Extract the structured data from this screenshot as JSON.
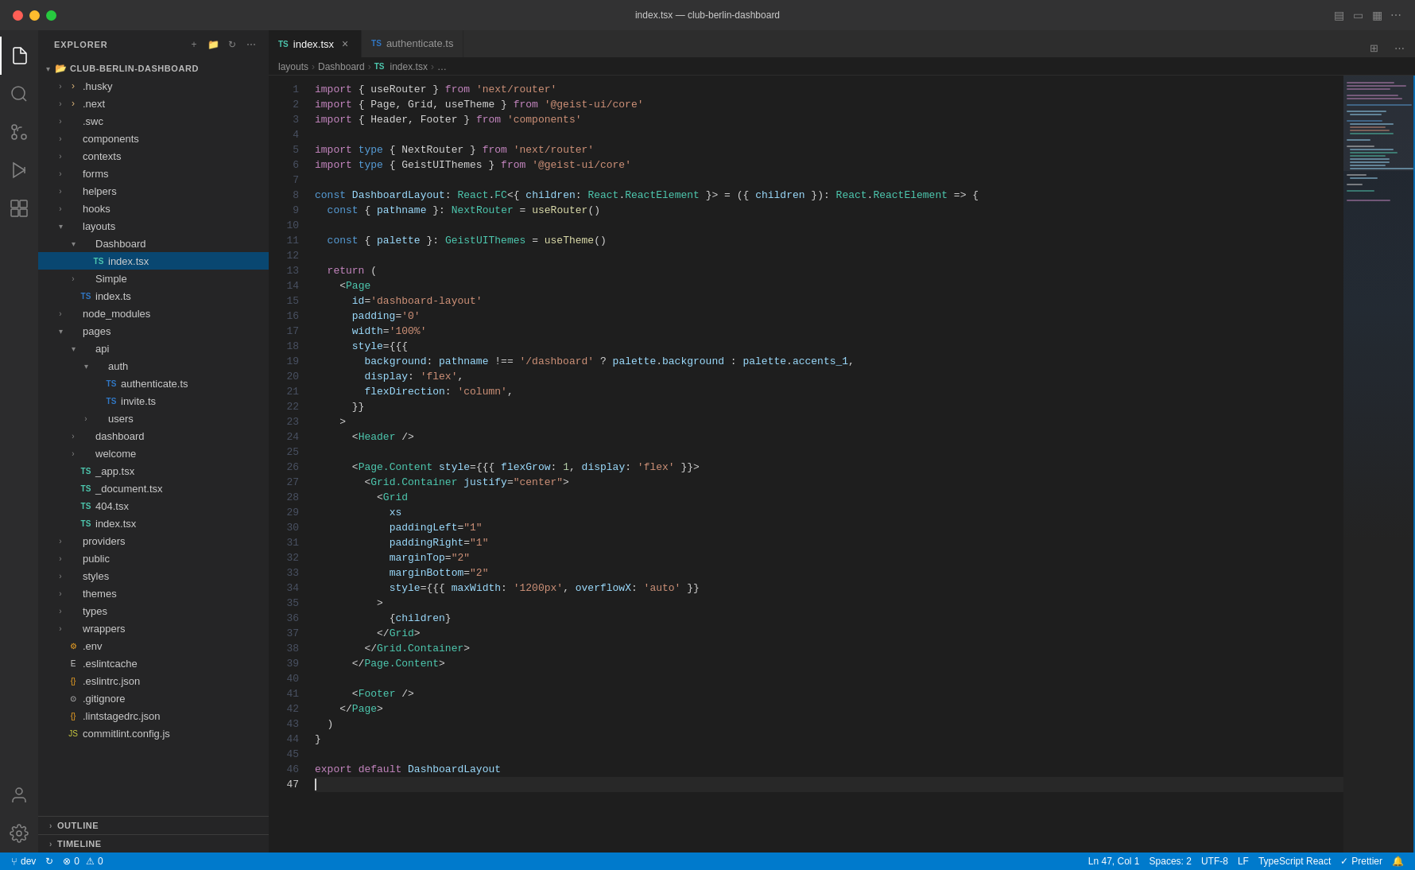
{
  "titlebar": {
    "title": "index.tsx — club-berlin-dashboard"
  },
  "activity_bar": {
    "icons": [
      {
        "name": "files-icon",
        "symbol": "📄",
        "active": true
      },
      {
        "name": "search-icon",
        "symbol": "🔍",
        "active": false
      },
      {
        "name": "source-control-icon",
        "symbol": "⑂",
        "active": false
      },
      {
        "name": "run-icon",
        "symbol": "▷",
        "active": false
      },
      {
        "name": "extensions-icon",
        "symbol": "⊞",
        "active": false
      }
    ],
    "bottom_icons": [
      {
        "name": "account-icon",
        "symbol": "👤",
        "active": false
      },
      {
        "name": "settings-icon",
        "symbol": "⚙",
        "active": false
      }
    ]
  },
  "sidebar": {
    "title": "EXPLORER",
    "root": "CLUB-BERLIN-DASHBOARD",
    "tree": [
      {
        "id": "husky",
        "label": ".husky",
        "type": "folder",
        "indent": 1,
        "open": false
      },
      {
        "id": "next",
        "label": ".next",
        "type": "folder",
        "indent": 1,
        "open": false
      },
      {
        "id": "swc",
        "label": ".swc",
        "type": "folder",
        "indent": 1,
        "open": false
      },
      {
        "id": "components",
        "label": "components",
        "type": "folder",
        "indent": 1,
        "open": false
      },
      {
        "id": "contexts",
        "label": "contexts",
        "type": "folder",
        "indent": 1,
        "open": false
      },
      {
        "id": "forms",
        "label": "forms",
        "type": "folder",
        "indent": 1,
        "open": false
      },
      {
        "id": "helpers",
        "label": "helpers",
        "type": "folder",
        "indent": 1,
        "open": false
      },
      {
        "id": "hooks",
        "label": "hooks",
        "type": "folder",
        "indent": 1,
        "open": false
      },
      {
        "id": "layouts",
        "label": "layouts",
        "type": "folder",
        "indent": 1,
        "open": true
      },
      {
        "id": "dashboard",
        "label": "Dashboard",
        "type": "folder",
        "indent": 2,
        "open": true
      },
      {
        "id": "index-tsx",
        "label": "index.tsx",
        "type": "tsx",
        "indent": 3,
        "open": false,
        "active": true
      },
      {
        "id": "simple",
        "label": "Simple",
        "type": "folder",
        "indent": 2,
        "open": false
      },
      {
        "id": "index-ts-layouts",
        "label": "index.ts",
        "type": "ts",
        "indent": 2,
        "open": false
      },
      {
        "id": "node_modules",
        "label": "node_modules",
        "type": "folder",
        "indent": 1,
        "open": false
      },
      {
        "id": "pages",
        "label": "pages",
        "type": "folder",
        "indent": 1,
        "open": true
      },
      {
        "id": "api",
        "label": "api",
        "type": "folder",
        "indent": 2,
        "open": true
      },
      {
        "id": "auth",
        "label": "auth",
        "type": "folder",
        "indent": 3,
        "open": true
      },
      {
        "id": "authenticate-ts",
        "label": "authenticate.ts",
        "type": "ts",
        "indent": 4,
        "open": false
      },
      {
        "id": "invite-ts",
        "label": "invite.ts",
        "type": "ts",
        "indent": 4,
        "open": false
      },
      {
        "id": "users",
        "label": "users",
        "type": "folder",
        "indent": 3,
        "open": false
      },
      {
        "id": "dashboard-page",
        "label": "dashboard",
        "type": "folder",
        "indent": 2,
        "open": false
      },
      {
        "id": "welcome",
        "label": "welcome",
        "type": "folder",
        "indent": 2,
        "open": false
      },
      {
        "id": "app-tsx",
        "label": "_app.tsx",
        "type": "tsx",
        "indent": 2,
        "open": false
      },
      {
        "id": "document-tsx",
        "label": "_document.tsx",
        "type": "tsx",
        "indent": 2,
        "open": false
      },
      {
        "id": "404-tsx",
        "label": "404.tsx",
        "type": "tsx",
        "indent": 2,
        "open": false
      },
      {
        "id": "index-tsx-pages",
        "label": "index.tsx",
        "type": "tsx",
        "indent": 2,
        "open": false
      },
      {
        "id": "providers",
        "label": "providers",
        "type": "folder",
        "indent": 1,
        "open": false
      },
      {
        "id": "public",
        "label": "public",
        "type": "folder",
        "indent": 1,
        "open": false
      },
      {
        "id": "styles",
        "label": "styles",
        "type": "folder",
        "indent": 1,
        "open": false
      },
      {
        "id": "themes",
        "label": "themes",
        "type": "folder",
        "indent": 1,
        "open": false
      },
      {
        "id": "types",
        "label": "types",
        "type": "folder",
        "indent": 1,
        "open": false
      },
      {
        "id": "wrappers",
        "label": "wrappers",
        "type": "folder",
        "indent": 1,
        "open": false
      },
      {
        "id": "env",
        "label": ".env",
        "type": "env",
        "indent": 1,
        "open": false
      },
      {
        "id": "eslintcache",
        "label": ".eslintcache",
        "type": "file",
        "indent": 1,
        "open": false
      },
      {
        "id": "eslintrc",
        "label": ".eslintrc.json",
        "type": "json",
        "indent": 1,
        "open": false
      },
      {
        "id": "gitignore",
        "label": ".gitignore",
        "type": "file",
        "indent": 1,
        "open": false
      },
      {
        "id": "lintstagedrc",
        "label": ".lintstagedrc.json",
        "type": "json",
        "indent": 1,
        "open": false
      },
      {
        "id": "commitlint",
        "label": "commitlint.config.js",
        "type": "js",
        "indent": 1,
        "open": false
      }
    ],
    "sections": [
      {
        "id": "outline",
        "label": "OUTLINE"
      },
      {
        "id": "timeline",
        "label": "TIMELINE"
      }
    ]
  },
  "tabs": [
    {
      "id": "index-tsx-tab",
      "label": "index.tsx",
      "lang": "TS",
      "active": true,
      "modified": false
    },
    {
      "id": "authenticate-ts-tab",
      "label": "authenticate.ts",
      "lang": "TS",
      "active": false,
      "modified": false
    }
  ],
  "breadcrumb": {
    "parts": [
      "layouts",
      "Dashboard",
      "TS index.tsx",
      "…"
    ]
  },
  "editor": {
    "lines": [
      {
        "n": 1,
        "code": "<kw>import</kw> <punct>{ useRouter }</punct> <kw>from</kw> <str>'next/router'</str>"
      },
      {
        "n": 2,
        "code": "<kw>import</kw> <punct>{ Page, Grid, useTheme }</punct> <kw>from</kw> <str>'@geist-ui/core'</str>"
      },
      {
        "n": 3,
        "code": "<kw>import</kw> <punct>{ Header, Footer }</punct> <kw>from</kw> <str>'components'</str>"
      },
      {
        "n": 4,
        "code": ""
      },
      {
        "n": 5,
        "code": "<kw>import</kw> <kw2>type</kw2> <punct>{ NextRouter }</punct> <kw>from</kw> <str>'next/router'</str>"
      },
      {
        "n": 6,
        "code": "<kw>import</kw> <kw2>type</kw2> <punct>{ GeistUIThemes }</punct> <kw>from</kw> <str>'@geist-ui/core'</str>"
      },
      {
        "n": 7,
        "code": ""
      },
      {
        "n": 8,
        "code": "<kw2>const</kw2> <var>DashboardLayout</var><punct>:</punct> <type>React</type><punct>.</punct><type>FC</type><punct>&lt;{</punct> <var>children</var><punct>:</punct> <type>React</type><punct>.</punct><type>ReactElement</type> <punct>}&gt;</punct> <op>=</op> <punct>({</punct> <var>children</var> <punct>}):</punct> <type>React</type><punct>.</punct><type>ReactElement</type> <op>=&gt;</op> <punct>{</punct>"
      },
      {
        "n": 9,
        "code": "  <kw2>const</kw2> <punct>{</punct> <var>pathname</var> <punct>}:</punct> <type>NextRouter</type> <op>=</op> <fn>useRouter</fn><punct>()</punct>"
      },
      {
        "n": 10,
        "code": ""
      },
      {
        "n": 11,
        "code": "  <kw2>const</kw2> <punct>{</punct> <var>palette</var> <punct>}:</punct> <type>GeistUIThemes</type> <op>=</op> <fn>useTheme</fn><punct>()</punct>"
      },
      {
        "n": 12,
        "code": ""
      },
      {
        "n": 13,
        "code": "  <kw>return</kw> <punct>(</punct>"
      },
      {
        "n": 14,
        "code": "    <punct>&lt;</punct><jsx>Page</jsx>"
      },
      {
        "n": 15,
        "code": "      <jsx-attr>id</jsx-attr><op>=</op><str>'dashboard-layout'</str>"
      },
      {
        "n": 16,
        "code": "      <jsx-attr>padding</jsx-attr><op>=</op><str>'0'</str>"
      },
      {
        "n": 17,
        "code": "      <jsx-attr>width</jsx-attr><op>=</op><str>'100%'</str>"
      },
      {
        "n": 18,
        "code": "      <jsx-attr>style</jsx-attr><op>={{</op>"
      },
      {
        "n": 19,
        "code": "        <var>background</var><punct>:</punct> <var>pathname</var> <op>!==</op> <str>'/dashboard'</str> <op>?</op> <var>palette</var><punct>.</punct><var>background</var> <op>:</op> <var>palette</var><punct>.</punct><var>accents_1</var><punct>,</punct>"
      },
      {
        "n": 20,
        "code": "        <var>display</var><punct>:</punct> <str>'flex'</str><punct>,</punct>"
      },
      {
        "n": 21,
        "code": "        <var>flexDirection</var><punct>:</punct> <str>'column'</str><punct>,</punct>"
      },
      {
        "n": 22,
        "code": "      <punct>}}</punct>"
      },
      {
        "n": 23,
        "code": "    <punct>&gt;</punct>"
      },
      {
        "n": 24,
        "code": "      <punct>&lt;</punct><jsx>Header</jsx> <punct>/&gt;</punct>"
      },
      {
        "n": 25,
        "code": ""
      },
      {
        "n": 26,
        "code": "      <punct>&lt;</punct><jsx>Page.Content</jsx> <jsx-attr>style</jsx-attr><op>={{</op> <var>flexGrow</var><punct>:</punct> <num>1</num><punct>,</punct> <var>display</var><punct>:</punct> <str>'flex'</str> <op>}}&gt;</op>"
      },
      {
        "n": 27,
        "code": "        <punct>&lt;</punct><jsx>Grid.Container</jsx> <jsx-attr>justify</jsx-attr><op>=</op><str>\"center\"</str><punct>&gt;</punct>"
      },
      {
        "n": 28,
        "code": "          <punct>&lt;</punct><jsx>Grid</jsx>"
      },
      {
        "n": 29,
        "code": "            <jsx-attr>xs</jsx-attr>"
      },
      {
        "n": 30,
        "code": "            <jsx-attr>paddingLeft</jsx-attr><op>=</op><str>\"1\"</str>"
      },
      {
        "n": 31,
        "code": "            <jsx-attr>paddingRight</jsx-attr><op>=</op><str>\"1\"</str>"
      },
      {
        "n": 32,
        "code": "            <jsx-attr>marginTop</jsx-attr><op>=</op><str>\"2\"</str>"
      },
      {
        "n": 33,
        "code": "            <jsx-attr>marginBottom</jsx-attr><op>=</op><str>\"2\"</str>"
      },
      {
        "n": 34,
        "code": "            <jsx-attr>style</jsx-attr><op>={{</op> <var>maxWidth</var><punct>:</punct> <str>'1200px'</str><punct>,</punct> <var>overflowX</var><punct>:</punct> <str>'auto'</str> <punct>}}</punct>"
      },
      {
        "n": 35,
        "code": "          <punct>&gt;</punct>"
      },
      {
        "n": 36,
        "code": "            <punct>{</punct><var>children</var><punct>}</punct>"
      },
      {
        "n": 37,
        "code": "          <punct>&lt;/</punct><jsx>Grid</jsx><punct>&gt;</punct>"
      },
      {
        "n": 38,
        "code": "        <punct>&lt;/</punct><jsx>Grid.Container</jsx><punct>&gt;</punct>"
      },
      {
        "n": 39,
        "code": "      <punct>&lt;/</punct><jsx>Page.Content</jsx><punct>&gt;</punct>"
      },
      {
        "n": 40,
        "code": ""
      },
      {
        "n": 41,
        "code": "      <punct>&lt;</punct><jsx>Footer</jsx> <punct>/&gt;</punct>"
      },
      {
        "n": 42,
        "code": "    <punct>&lt;/</punct><jsx>Page</jsx><punct>&gt;</punct>"
      },
      {
        "n": 43,
        "code": "  <punct>)</punct>"
      },
      {
        "n": 44,
        "code": "<punct>}</punct>"
      },
      {
        "n": 45,
        "code": ""
      },
      {
        "n": 46,
        "code": "<kw>export</kw> <kw>default</kw> <var>DashboardLayout</var>"
      },
      {
        "n": 47,
        "code": ""
      }
    ]
  },
  "status_bar": {
    "branch": "dev",
    "errors": "0",
    "warnings": "0",
    "position": "Ln 47, Col 1",
    "spaces": "Spaces: 2",
    "encoding": "UTF-8",
    "line_ending": "LF",
    "language": "TypeScript React",
    "formatter": "Prettier",
    "sync_icon": "↻",
    "bell_icon": "🔔",
    "error_icon": "⊗",
    "warning_icon": "⚠"
  }
}
